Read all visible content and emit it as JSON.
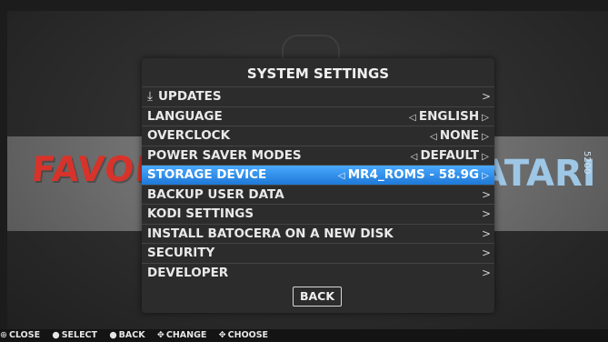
{
  "background": {
    "left_banner": "FAVORIT",
    "right_banner": "ATARI",
    "right_banner_small": "5200"
  },
  "dialog": {
    "title": "SYSTEM SETTINGS",
    "items": [
      {
        "label": "UPDATES",
        "icon": "download-icon",
        "icon_glyph": "⤓",
        "value": "",
        "chevron": ">"
      },
      {
        "label": "LANGUAGE",
        "value": "ENGLISH",
        "chevron": ""
      },
      {
        "label": "OVERCLOCK",
        "value": "NONE",
        "chevron": ""
      },
      {
        "label": "POWER SAVER MODES",
        "value": "DEFAULT",
        "chevron": ""
      },
      {
        "label": "STORAGE DEVICE",
        "value": "MR4_ROMS - 58.9G",
        "chevron": "",
        "selected": true
      },
      {
        "label": "BACKUP USER DATA",
        "value": "",
        "chevron": ">"
      },
      {
        "label": "KODI SETTINGS",
        "value": "",
        "chevron": ">"
      },
      {
        "label": "INSTALL BATOCERA ON A NEW DISK",
        "value": "",
        "chevron": ">"
      },
      {
        "label": "SECURITY",
        "value": "",
        "chevron": ">"
      },
      {
        "label": "DEVELOPER",
        "value": "",
        "chevron": ">"
      }
    ],
    "back_label": "BACK"
  },
  "help_bar": {
    "items": [
      "CLOSE",
      "SELECT",
      "BACK",
      "CHANGE",
      "CHOOSE"
    ]
  },
  "colors": {
    "selection": "#2f8ff0",
    "dialog_bg": "#2c2c2c",
    "band_bg": "#8b8b8b"
  }
}
